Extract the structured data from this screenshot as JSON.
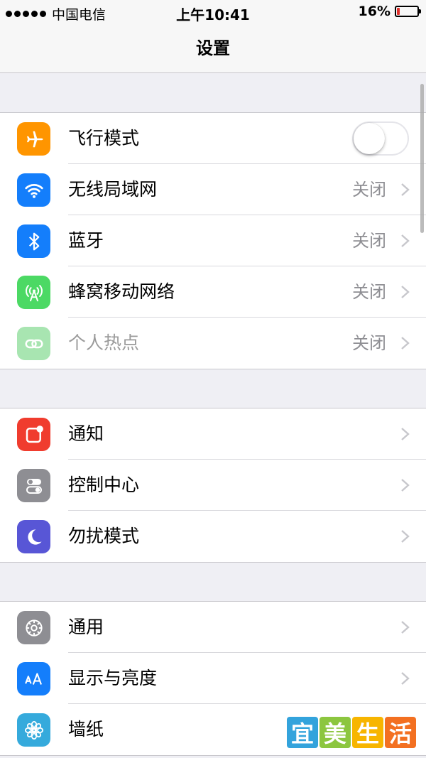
{
  "status_bar": {
    "carrier": "中国电信",
    "time": "上午10:41",
    "battery_percent": "16%",
    "battery_level": 0.16,
    "signal_dots": 5
  },
  "nav": {
    "title": "设置"
  },
  "groups": [
    {
      "rows": [
        {
          "label": "飞行模式",
          "icon": "airplane-icon",
          "icon_color": "#ff9500",
          "control": "toggle",
          "toggle_on": false
        },
        {
          "label": "无线局域网",
          "icon": "wifi-icon",
          "icon_color": "#147efb",
          "value": "关闭"
        },
        {
          "label": "蓝牙",
          "icon": "bluetooth-icon",
          "icon_color": "#147efb",
          "value": "关闭"
        },
        {
          "label": "蜂窝移动网络",
          "icon": "cellular-antenna-icon",
          "icon_color": "#4cd964",
          "value": "关闭"
        },
        {
          "label": "个人热点",
          "icon": "hotspot-icon",
          "icon_color": "#a8e5b1",
          "value": "关闭",
          "disabled": true
        }
      ]
    },
    {
      "rows": [
        {
          "label": "通知",
          "icon": "notifications-icon",
          "icon_color": "#f03c2e"
        },
        {
          "label": "控制中心",
          "icon": "control-center-icon",
          "icon_color": "#8e8e93"
        },
        {
          "label": "勿扰模式",
          "icon": "moon-icon",
          "icon_color": "#5856d6"
        }
      ]
    },
    {
      "rows": [
        {
          "label": "通用",
          "icon": "gear-icon",
          "icon_color": "#8e8e93"
        },
        {
          "label": "显示与亮度",
          "icon": "text-size-icon",
          "icon_color": "#147efb"
        },
        {
          "label": "墙纸",
          "icon": "flower-icon",
          "icon_color": "#35aadc"
        }
      ]
    }
  ],
  "watermark": {
    "chars": [
      "宜",
      "美",
      "生",
      "活"
    ],
    "colors": [
      "#33a3dc",
      "#8cc63f",
      "#f7b500",
      "#f37021"
    ]
  }
}
